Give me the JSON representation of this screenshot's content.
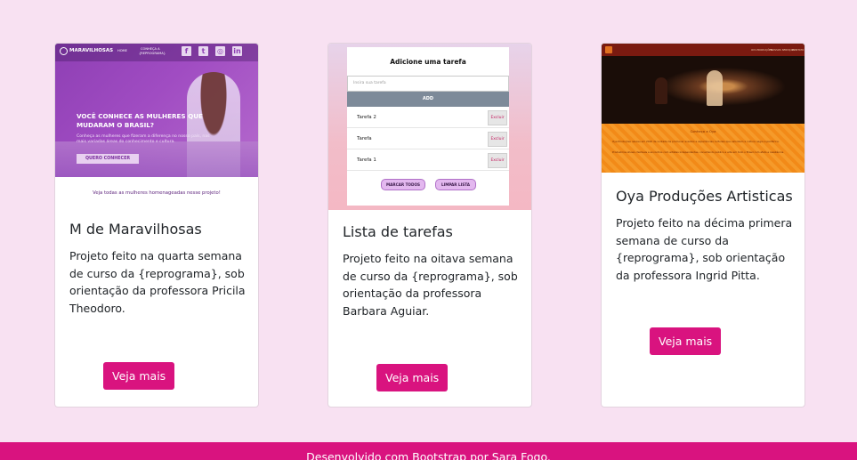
{
  "cards": [
    {
      "title": "M de Maravilhosas",
      "text": "Projeto feito na quarta semana de curso da {reprograma}, sob orientação da professora Pricila Theodoro.",
      "button": "Veja mais",
      "thumbnail": {
        "logo": "MARAVILHOSAS",
        "nav": [
          "HOME",
          "CONHEÇA A",
          "{REPROGRAMA}"
        ],
        "social_icons": [
          "facebook-icon",
          "twitter-icon",
          "instagram-icon",
          "linkedin-icon"
        ],
        "headline_1": "VOCÊ CONHECE AS MULHERES QUE",
        "headline_2": "MUDARAM O BRASIL?",
        "sub_1": "Conheça as mulheres que fizeram a diferença no nosso país, nas",
        "sub_2": "mais variadas áreas do conhecimento e cultura.",
        "cta": "QUERO CONHECER",
        "caption": "Veja todas as mulheres homenageadas nesse projeto!"
      }
    },
    {
      "title": "Lista de tarefas",
      "text": "Projeto feito na oitava semana de curso da {reprograma}, sob orientação da professora Barbara Aguiar.",
      "button": "Veja mais",
      "thumbnail": {
        "title": "Adicione uma tarefa",
        "placeholder": "Insira sua tarefa",
        "add": "ADD",
        "tasks": [
          "Tarefa 2",
          "Tarefa",
          "Tarefa 1"
        ],
        "delete_label": "Excluir",
        "mark_all": "MARCAR TODOS",
        "clear_list": "LIMPAR LISTA"
      }
    },
    {
      "title": "Oya Produções Artisticas",
      "text": "Projeto feito na décima primera semana de curso da {reprograma}, sob orientação da professora Ingrid Pitta.",
      "button": "Veja mais",
      "thumbnail": {
        "nav": [
          "OYA PRODUÇÕES",
          "NOSSOS SERVIÇOS",
          "CONTATO"
        ],
        "section_title": "Conheça a Oya",
        "text_1": "Oya Produções nasceu em 2016 da vontade de promover eventos e experiências culturais que valorizem a cultura negra e periférica.",
        "text_2": "Produzimos shows, festivais e encontros com artistas independentes, conectando público e arte em todo o Brasil com afeto e resistência."
      }
    }
  ],
  "footer": {
    "text": "Desenvolvido com Bootstrap por Sara Fogo."
  },
  "colors": {
    "background": "#f8e1f2",
    "accent": "#d9137f",
    "card": "#ffffff"
  }
}
